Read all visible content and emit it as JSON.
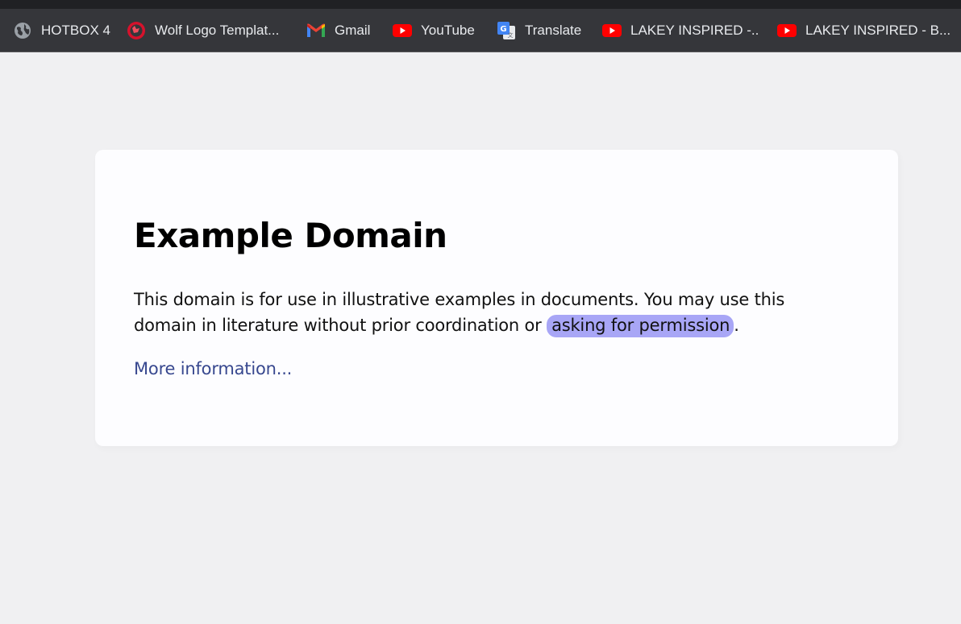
{
  "bookmarks": {
    "items": [
      {
        "label": "HOTBOX 4",
        "icon": "globe-icon"
      },
      {
        "label": "Wolf Logo Templat...",
        "icon": "wolf-logo-icon"
      },
      {
        "label": "Gmail",
        "icon": "gmail-icon"
      },
      {
        "label": "YouTube",
        "icon": "youtube-icon"
      },
      {
        "label": "Translate",
        "icon": "google-translate-icon"
      },
      {
        "label": "LAKEY INSPIRED -...",
        "icon": "youtube-icon"
      },
      {
        "label": "LAKEY INSPIRED - B...",
        "icon": "youtube-icon"
      }
    ]
  },
  "page": {
    "title": "Example Domain",
    "paragraph_before_link": "This domain is for use in illustrative examples in documents. You may use this domain in literature without prior coordination or ",
    "permission_link": "asking for permission",
    "paragraph_after_link": ".",
    "more_info_link": "More information..."
  },
  "colors": {
    "bookmarks_bar_bg": "#35363a",
    "page_bg": "#f0f0f2",
    "card_bg": "#fdfdff",
    "link_color": "#38488f",
    "highlight_bg": "#a8a6f6",
    "youtube_red": "#ff0000"
  }
}
